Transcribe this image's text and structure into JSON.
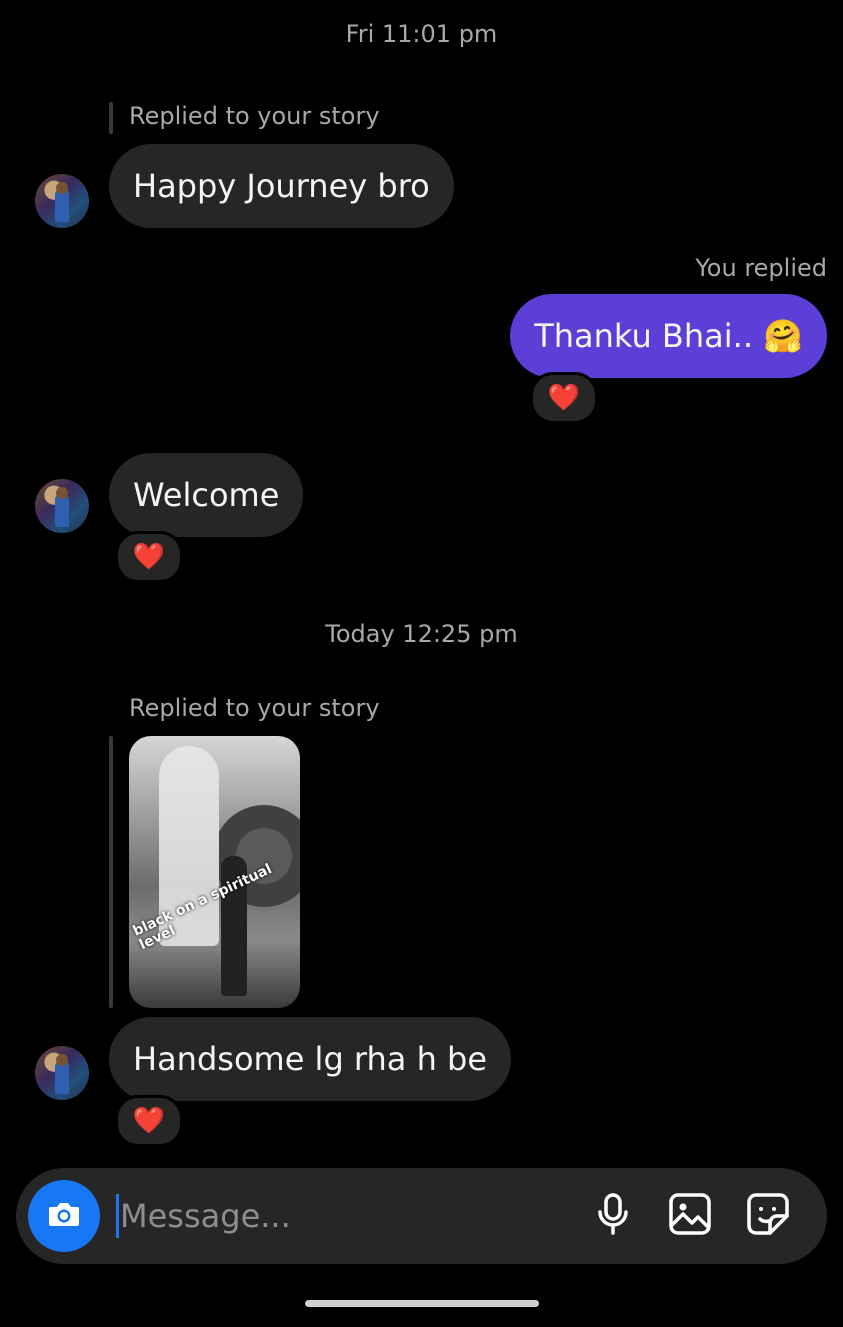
{
  "conversation": {
    "timestamps": [
      "Fri 11:01 pm",
      "Today 12:25 pm"
    ],
    "messages": [
      {
        "from": "them",
        "context": "Replied to your story",
        "text": "Happy Journey bro"
      },
      {
        "from": "me",
        "context": "You replied",
        "text": "Thanku Bhai.. 🤗",
        "reaction": "❤️"
      },
      {
        "from": "them",
        "text": "Welcome",
        "reaction": "❤️"
      },
      {
        "from": "them",
        "context": "Replied to your story",
        "story_caption": "black on a spiritual level",
        "text": "Handsome lg rha h be",
        "reaction": "❤️"
      }
    ]
  },
  "composer": {
    "placeholder": "Message...",
    "icons": [
      "camera-icon",
      "microphone-icon",
      "gallery-icon",
      "sticker-icon"
    ]
  },
  "colors": {
    "background": "#000000",
    "their_bubble": "#262626",
    "my_bubble": "#5b3fd6",
    "accent": "#1877f2",
    "muted_text": "#a8a8a8"
  }
}
